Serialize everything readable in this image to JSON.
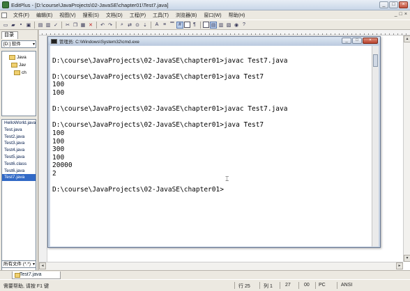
{
  "app": {
    "title": "EditPlus - [D:\\course\\JavaProjects\\02-JavaSE\\chapter01\\Test7.java]",
    "window_buttons": [
      "_",
      "□",
      "×"
    ]
  },
  "menu": {
    "items": [
      "文件(F)",
      "编辑(E)",
      "视图(V)",
      "搜索(S)",
      "文档(D)",
      "工程(P)",
      "工具(T)",
      "浏览器(B)",
      "窗口(W)",
      "帮助(H)"
    ],
    "mdi_buttons": [
      "_",
      "□",
      "×"
    ]
  },
  "sidebar": {
    "tab_label": "目录",
    "drive": "[D:] 软件",
    "folders": [
      "Java",
      "Jav",
      "ch"
    ],
    "files": [
      "HelloWorld.java",
      "Test.java",
      "Test2.java",
      "Test3.java",
      "Test4.java",
      "Test5.java",
      "Test6.class",
      "Test6.java",
      "Test7.java"
    ],
    "selected_file": "Test7.java",
    "filter": "所有文件 (*.*)"
  },
  "cmd": {
    "title": "管理员: C:\\Windows\\System32\\cmd.exe",
    "lines": [
      "",
      "D:\\course\\JavaProjects\\02-JavaSE\\chapter01>javac Test7.java",
      "",
      "D:\\course\\JavaProjects\\02-JavaSE\\chapter01>java Test7",
      "100",
      "100",
      "",
      "D:\\course\\JavaProjects\\02-JavaSE\\chapter01>javac Test7.java",
      "",
      "D:\\course\\JavaProjects\\02-JavaSE\\chapter01>java Test7",
      "100",
      "100",
      "300",
      "100",
      "20000",
      "2",
      "",
      "D:\\course\\JavaProjects\\02-JavaSE\\chapter01>"
    ]
  },
  "doc_tab": {
    "label": "Test7.java"
  },
  "status": {
    "help": "需要帮助, 请按 F1 键",
    "line": "行 25",
    "col": "列 1",
    "num1": "27",
    "num2": "00",
    "mode": "PC",
    "encoding": "ANSI"
  }
}
